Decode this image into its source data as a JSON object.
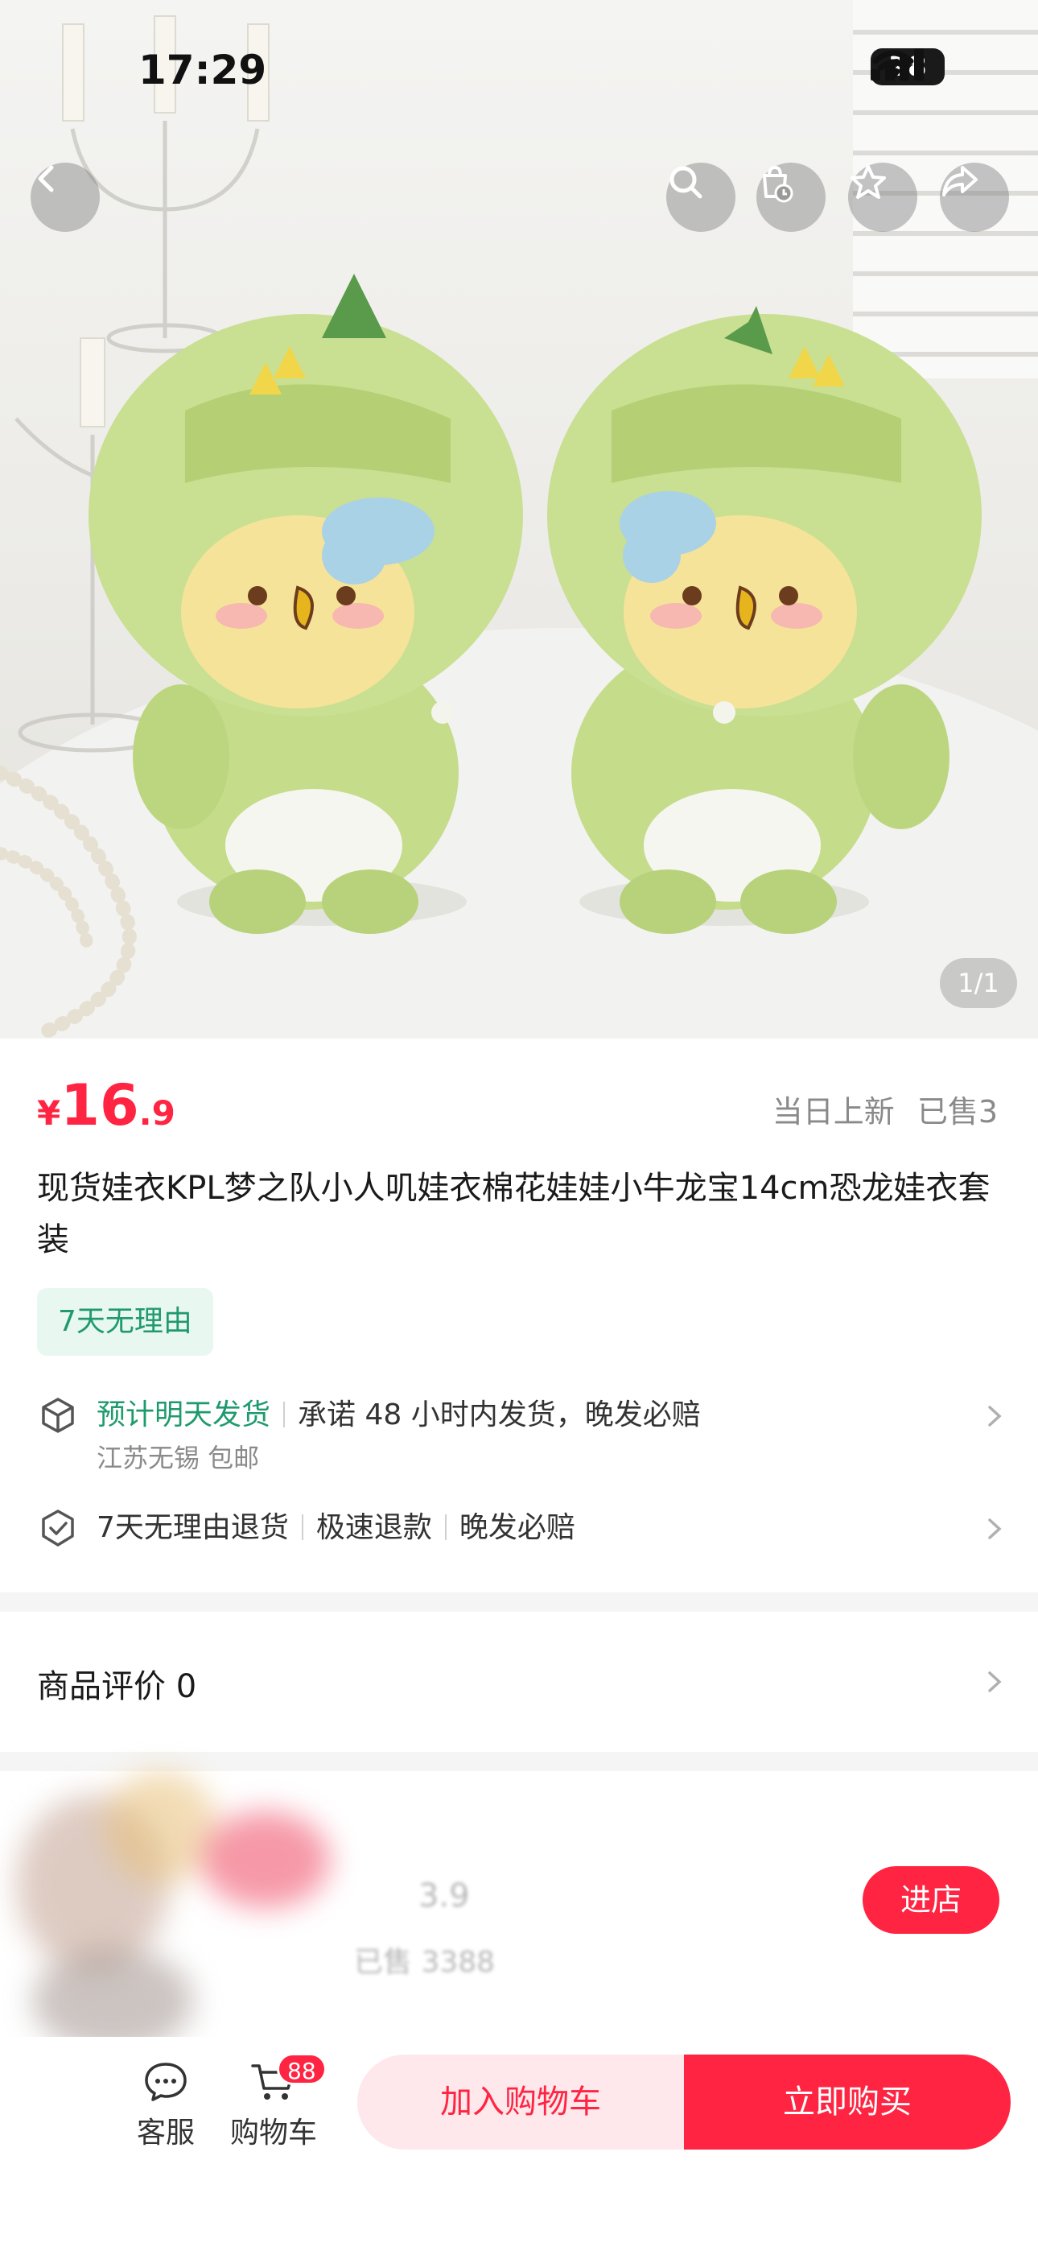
{
  "status_bar": {
    "time": "17:29",
    "battery": "28"
  },
  "gallery": {
    "page_indicator": "1/1"
  },
  "product": {
    "price_currency": "¥",
    "price_integer": "16",
    "price_decimal": ".9",
    "listed": "当日上新",
    "sold": "已售3",
    "title": "现货娃衣KPL梦之队小人叽娃衣棉花娃娃小牛龙宝14cm恐龙娃衣套装",
    "tag": "7天无理由"
  },
  "shipping": {
    "estimate": "预计明天发货",
    "promise": "承诺 48 小时内发货，晚发必赔",
    "origin": "江苏无锡  包邮"
  },
  "guarantee": {
    "item1": "7天无理由退货",
    "item2": "极速退款",
    "item3": "晚发必赔"
  },
  "reviews": {
    "label": "商品评价 0"
  },
  "store": {
    "rating_fragment": "3.9",
    "sold_label": "已售 3388",
    "enter_label": "进店"
  },
  "bottom_bar": {
    "service_label": "客服",
    "cart_label": "购物车",
    "cart_badge": "88",
    "add_to_cart": "加入购物车",
    "buy_now": "立即购买"
  },
  "colors": {
    "accent": "#ff2442",
    "green": "#1f9a6e"
  },
  "icons": [
    "back-icon",
    "search-icon",
    "cart-clock-icon",
    "star-icon",
    "share-icon",
    "box-icon",
    "shield-check-icon",
    "chevron-right-icon",
    "chat-icon",
    "cart-icon"
  ]
}
